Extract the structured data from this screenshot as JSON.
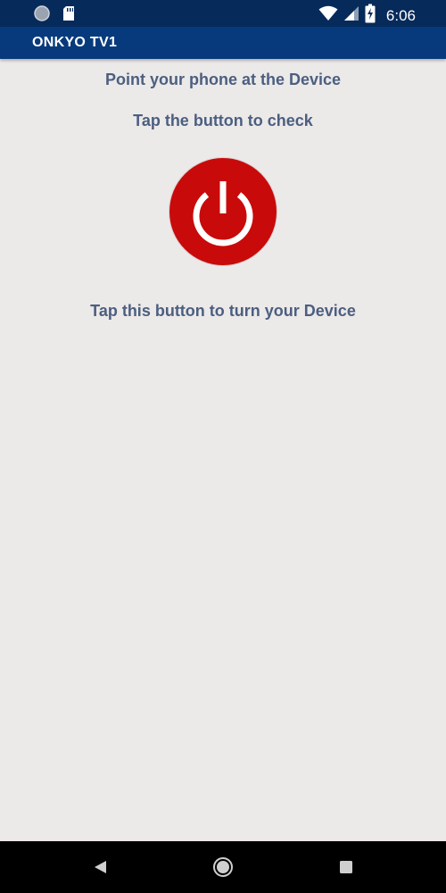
{
  "status_bar": {
    "time": "6:06",
    "icons": [
      "circle-notification-icon",
      "sd-card-icon",
      "wifi-icon",
      "cell-signal-icon",
      "battery-charging-icon"
    ]
  },
  "app_bar": {
    "title": "ONKYO TV1"
  },
  "main": {
    "instruction_point": "Point your phone at the Device",
    "instruction_check": "Tap the button to check",
    "power_button_icon": "power-icon",
    "power_button_color": "#c90a0a",
    "instruction_turn": "Tap this button to turn your Device"
  },
  "nav_bar": {
    "icons": [
      "back-icon",
      "home-icon",
      "recents-icon"
    ]
  },
  "colors": {
    "status_bar": "#062a5a",
    "app_bar": "#073a7c",
    "background": "#ece9e9",
    "instruction_text": "#4b5f80"
  }
}
